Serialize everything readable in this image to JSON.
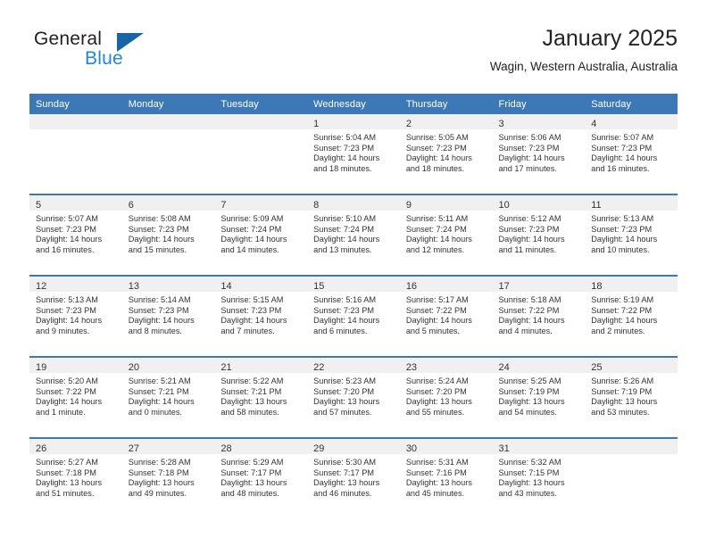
{
  "brand": {
    "name_top": "General",
    "name_bottom": "Blue",
    "triangle_color": "#1565a8",
    "blue_color": "#2186d4"
  },
  "header": {
    "title": "January 2025",
    "subtitle": "Wagin, Western Australia, Australia"
  },
  "theme": {
    "header_blue": "#3b78b5",
    "daynum_band": "#f0f0f0",
    "text": "#333333"
  },
  "weekday_headers": [
    "Sunday",
    "Monday",
    "Tuesday",
    "Wednesday",
    "Thursday",
    "Friday",
    "Saturday"
  ],
  "labels": {
    "sunrise_prefix": "Sunrise: ",
    "sunset_prefix": "Sunset: ",
    "daylight_prefix": "Daylight: "
  },
  "weeks": [
    [
      {
        "day": "",
        "empty": true
      },
      {
        "day": "",
        "empty": true
      },
      {
        "day": "",
        "empty": true
      },
      {
        "day": "1",
        "sunrise": "Sunrise: 5:04 AM",
        "sunset": "Sunset: 7:23 PM",
        "daylight_line1": "Daylight: 14 hours",
        "daylight_line2": "and 18 minutes."
      },
      {
        "day": "2",
        "sunrise": "Sunrise: 5:05 AM",
        "sunset": "Sunset: 7:23 PM",
        "daylight_line1": "Daylight: 14 hours",
        "daylight_line2": "and 18 minutes."
      },
      {
        "day": "3",
        "sunrise": "Sunrise: 5:06 AM",
        "sunset": "Sunset: 7:23 PM",
        "daylight_line1": "Daylight: 14 hours",
        "daylight_line2": "and 17 minutes."
      },
      {
        "day": "4",
        "sunrise": "Sunrise: 5:07 AM",
        "sunset": "Sunset: 7:23 PM",
        "daylight_line1": "Daylight: 14 hours",
        "daylight_line2": "and 16 minutes."
      }
    ],
    [
      {
        "day": "5",
        "sunrise": "Sunrise: 5:07 AM",
        "sunset": "Sunset: 7:23 PM",
        "daylight_line1": "Daylight: 14 hours",
        "daylight_line2": "and 16 minutes."
      },
      {
        "day": "6",
        "sunrise": "Sunrise: 5:08 AM",
        "sunset": "Sunset: 7:23 PM",
        "daylight_line1": "Daylight: 14 hours",
        "daylight_line2": "and 15 minutes."
      },
      {
        "day": "7",
        "sunrise": "Sunrise: 5:09 AM",
        "sunset": "Sunset: 7:24 PM",
        "daylight_line1": "Daylight: 14 hours",
        "daylight_line2": "and 14 minutes."
      },
      {
        "day": "8",
        "sunrise": "Sunrise: 5:10 AM",
        "sunset": "Sunset: 7:24 PM",
        "daylight_line1": "Daylight: 14 hours",
        "daylight_line2": "and 13 minutes."
      },
      {
        "day": "9",
        "sunrise": "Sunrise: 5:11 AM",
        "sunset": "Sunset: 7:24 PM",
        "daylight_line1": "Daylight: 14 hours",
        "daylight_line2": "and 12 minutes."
      },
      {
        "day": "10",
        "sunrise": "Sunrise: 5:12 AM",
        "sunset": "Sunset: 7:23 PM",
        "daylight_line1": "Daylight: 14 hours",
        "daylight_line2": "and 11 minutes."
      },
      {
        "day": "11",
        "sunrise": "Sunrise: 5:13 AM",
        "sunset": "Sunset: 7:23 PM",
        "daylight_line1": "Daylight: 14 hours",
        "daylight_line2": "and 10 minutes."
      }
    ],
    [
      {
        "day": "12",
        "sunrise": "Sunrise: 5:13 AM",
        "sunset": "Sunset: 7:23 PM",
        "daylight_line1": "Daylight: 14 hours",
        "daylight_line2": "and 9 minutes."
      },
      {
        "day": "13",
        "sunrise": "Sunrise: 5:14 AM",
        "sunset": "Sunset: 7:23 PM",
        "daylight_line1": "Daylight: 14 hours",
        "daylight_line2": "and 8 minutes."
      },
      {
        "day": "14",
        "sunrise": "Sunrise: 5:15 AM",
        "sunset": "Sunset: 7:23 PM",
        "daylight_line1": "Daylight: 14 hours",
        "daylight_line2": "and 7 minutes."
      },
      {
        "day": "15",
        "sunrise": "Sunrise: 5:16 AM",
        "sunset": "Sunset: 7:23 PM",
        "daylight_line1": "Daylight: 14 hours",
        "daylight_line2": "and 6 minutes."
      },
      {
        "day": "16",
        "sunrise": "Sunrise: 5:17 AM",
        "sunset": "Sunset: 7:22 PM",
        "daylight_line1": "Daylight: 14 hours",
        "daylight_line2": "and 5 minutes."
      },
      {
        "day": "17",
        "sunrise": "Sunrise: 5:18 AM",
        "sunset": "Sunset: 7:22 PM",
        "daylight_line1": "Daylight: 14 hours",
        "daylight_line2": "and 4 minutes."
      },
      {
        "day": "18",
        "sunrise": "Sunrise: 5:19 AM",
        "sunset": "Sunset: 7:22 PM",
        "daylight_line1": "Daylight: 14 hours",
        "daylight_line2": "and 2 minutes."
      }
    ],
    [
      {
        "day": "19",
        "sunrise": "Sunrise: 5:20 AM",
        "sunset": "Sunset: 7:22 PM",
        "daylight_line1": "Daylight: 14 hours",
        "daylight_line2": "and 1 minute."
      },
      {
        "day": "20",
        "sunrise": "Sunrise: 5:21 AM",
        "sunset": "Sunset: 7:21 PM",
        "daylight_line1": "Daylight: 14 hours",
        "daylight_line2": "and 0 minutes."
      },
      {
        "day": "21",
        "sunrise": "Sunrise: 5:22 AM",
        "sunset": "Sunset: 7:21 PM",
        "daylight_line1": "Daylight: 13 hours",
        "daylight_line2": "and 58 minutes."
      },
      {
        "day": "22",
        "sunrise": "Sunrise: 5:23 AM",
        "sunset": "Sunset: 7:20 PM",
        "daylight_line1": "Daylight: 13 hours",
        "daylight_line2": "and 57 minutes."
      },
      {
        "day": "23",
        "sunrise": "Sunrise: 5:24 AM",
        "sunset": "Sunset: 7:20 PM",
        "daylight_line1": "Daylight: 13 hours",
        "daylight_line2": "and 55 minutes."
      },
      {
        "day": "24",
        "sunrise": "Sunrise: 5:25 AM",
        "sunset": "Sunset: 7:19 PM",
        "daylight_line1": "Daylight: 13 hours",
        "daylight_line2": "and 54 minutes."
      },
      {
        "day": "25",
        "sunrise": "Sunrise: 5:26 AM",
        "sunset": "Sunset: 7:19 PM",
        "daylight_line1": "Daylight: 13 hours",
        "daylight_line2": "and 53 minutes."
      }
    ],
    [
      {
        "day": "26",
        "sunrise": "Sunrise: 5:27 AM",
        "sunset": "Sunset: 7:18 PM",
        "daylight_line1": "Daylight: 13 hours",
        "daylight_line2": "and 51 minutes."
      },
      {
        "day": "27",
        "sunrise": "Sunrise: 5:28 AM",
        "sunset": "Sunset: 7:18 PM",
        "daylight_line1": "Daylight: 13 hours",
        "daylight_line2": "and 49 minutes."
      },
      {
        "day": "28",
        "sunrise": "Sunrise: 5:29 AM",
        "sunset": "Sunset: 7:17 PM",
        "daylight_line1": "Daylight: 13 hours",
        "daylight_line2": "and 48 minutes."
      },
      {
        "day": "29",
        "sunrise": "Sunrise: 5:30 AM",
        "sunset": "Sunset: 7:17 PM",
        "daylight_line1": "Daylight: 13 hours",
        "daylight_line2": "and 46 minutes."
      },
      {
        "day": "30",
        "sunrise": "Sunrise: 5:31 AM",
        "sunset": "Sunset: 7:16 PM",
        "daylight_line1": "Daylight: 13 hours",
        "daylight_line2": "and 45 minutes."
      },
      {
        "day": "31",
        "sunrise": "Sunrise: 5:32 AM",
        "sunset": "Sunset: 7:15 PM",
        "daylight_line1": "Daylight: 13 hours",
        "daylight_line2": "and 43 minutes."
      },
      {
        "day": "",
        "empty": true
      }
    ]
  ]
}
